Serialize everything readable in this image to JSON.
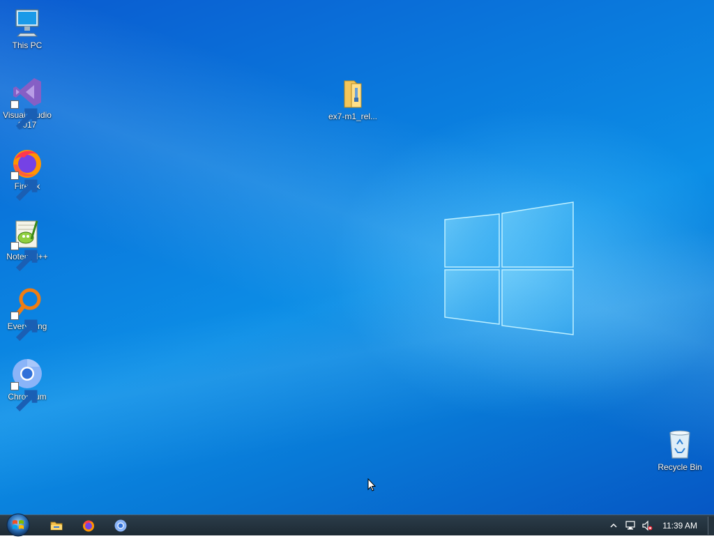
{
  "desktop": {
    "icons": [
      {
        "label": "This PC",
        "icon": "this-pc-icon"
      },
      {
        "label": "Visual Studio 2017",
        "icon": "visual-studio-icon"
      },
      {
        "label": "Firefox",
        "icon": "firefox-icon"
      },
      {
        "label": "Notepad++",
        "icon": "notepad-plus-plus-icon"
      },
      {
        "label": "Everything",
        "icon": "everything-search-icon"
      },
      {
        "label": "Chromium",
        "icon": "chromium-icon"
      },
      {
        "label": "ex7-m1_rel...",
        "icon": "folder-zip-icon"
      },
      {
        "label": "Recycle Bin",
        "icon": "recycle-bin-icon"
      }
    ]
  },
  "taskbar": {
    "pinned": [
      {
        "name": "File Explorer",
        "icon": "file-explorer-icon"
      },
      {
        "name": "Firefox",
        "icon": "firefox-icon"
      },
      {
        "name": "Chromium",
        "icon": "chromium-icon"
      }
    ],
    "tray": {
      "icons": [
        "show-hidden-icons-chevron",
        "network-icon",
        "volume-muted-icon"
      ],
      "clock": "11:39 AM"
    }
  },
  "colors": {
    "desktop_blue": "#0a78dc",
    "taskbar": "#25343f",
    "logo_glow": "#7fd6ff"
  }
}
